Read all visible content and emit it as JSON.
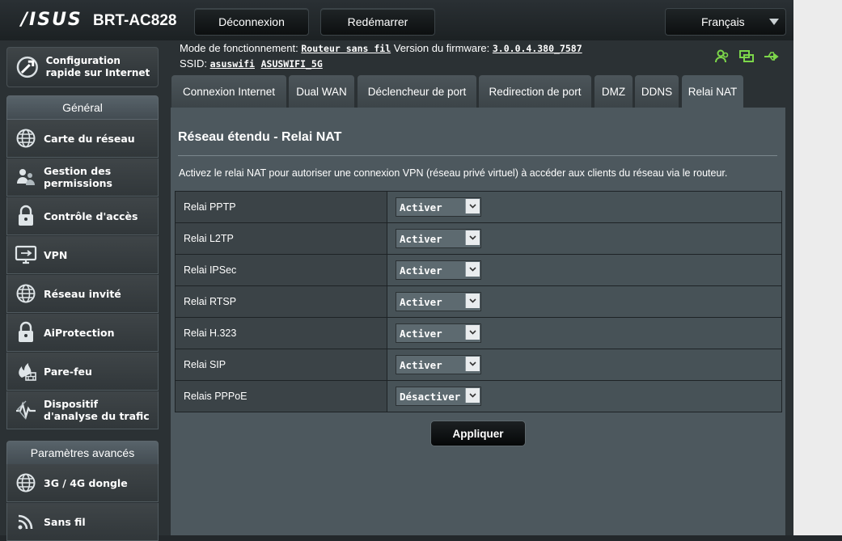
{
  "header": {
    "brand": "/ISUS",
    "model": "BRT-AC828",
    "logout_label": "Déconnexion",
    "reboot_label": "Redémarrer",
    "language": "Français"
  },
  "info": {
    "mode_label": "Mode de fonctionnement:",
    "mode_value": "Routeur sans fil",
    "firmware_label": "Version du firmware:",
    "firmware_value": "3.0.0.4.380_7587",
    "ssid_label": "SSID:",
    "ssid_1": "asuswifi",
    "ssid_2": "ASUSWIFI_5G"
  },
  "sidebar": {
    "quick_setup": "Configuration rapide sur Internet",
    "section_general": "Général",
    "general_items": [
      {
        "label": "Carte du réseau",
        "icon": "globe-icon"
      },
      {
        "label": "Gestion des permissions",
        "icon": "users-icon"
      },
      {
        "label": "Contrôle d'accès",
        "icon": "lock-icon"
      },
      {
        "label": "VPN",
        "icon": "monitor-icon"
      },
      {
        "label": "Réseau invité",
        "icon": "globe-icon"
      },
      {
        "label": "AiProtection",
        "icon": "lock-icon"
      },
      {
        "label": "Pare-feu",
        "icon": "firewall-icon"
      },
      {
        "label": "Dispositif d'analyse du trafic",
        "icon": "traffic-icon"
      }
    ],
    "section_advanced": "Paramètres avancés",
    "advanced_items": [
      {
        "label": "3G / 4G dongle",
        "icon": "globe-icon"
      },
      {
        "label": "Sans fil",
        "icon": "wifi-icon"
      }
    ]
  },
  "tabs": [
    {
      "label": "Connexion Internet"
    },
    {
      "label": "Dual WAN"
    },
    {
      "label": "Déclencheur de port"
    },
    {
      "label": "Redirection de port"
    },
    {
      "label": "DMZ"
    },
    {
      "label": "DDNS"
    },
    {
      "label": "Relai NAT",
      "active": true
    }
  ],
  "content": {
    "title": "Réseau étendu - Relai NAT",
    "description": "Activez le relai NAT pour autoriser une connexion VPN (réseau privé virtuel) à accéder aux clients du réseau via le routeur.",
    "rows": [
      {
        "label": "Relai PPTP",
        "value": "Activer"
      },
      {
        "label": "Relai L2TP",
        "value": "Activer"
      },
      {
        "label": "Relai IPSec",
        "value": "Activer"
      },
      {
        "label": "Relai RTSP",
        "value": "Activer"
      },
      {
        "label": "Relai H.323",
        "value": "Activer"
      },
      {
        "label": "Relai SIP",
        "value": "Activer"
      },
      {
        "label": "Relais PPPoE",
        "value": "Désactiver"
      }
    ],
    "apply_label": "Appliquer"
  },
  "colors": {
    "accent_green": "#7cd64a",
    "panel": "#4d585e"
  }
}
